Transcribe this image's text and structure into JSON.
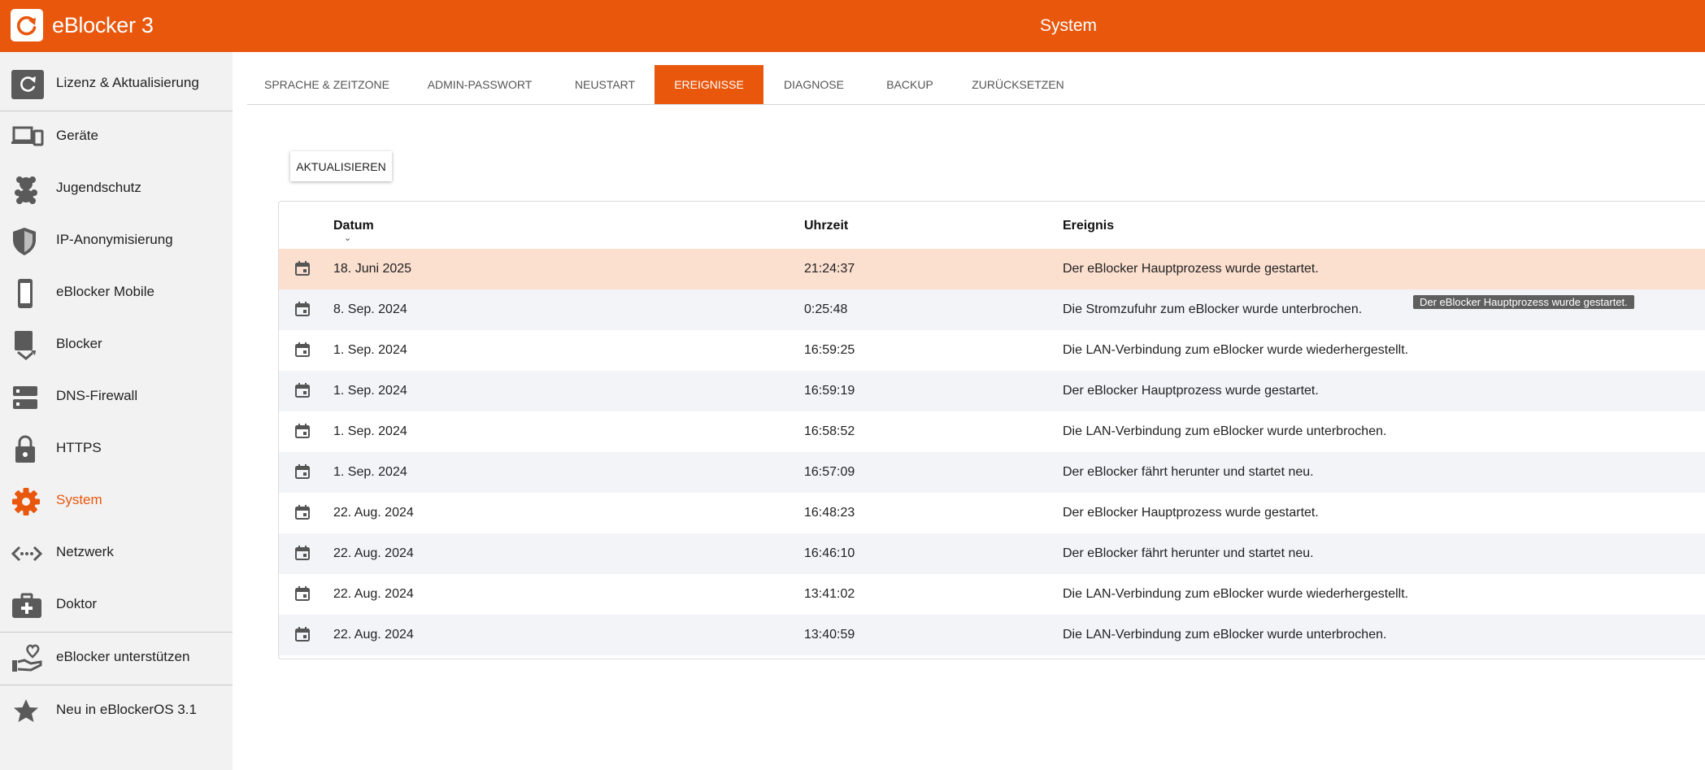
{
  "app": {
    "brand": "eBlocker 3",
    "page_title": "System"
  },
  "sidebar": {
    "items": [
      {
        "label": "Lizenz & Aktualisierung",
        "icon": "license-update-icon"
      },
      {
        "label": "Geräte",
        "icon": "devices-icon"
      },
      {
        "label": "Jugendschutz",
        "icon": "teddy-bear-icon"
      },
      {
        "label": "IP-Anonymisierung",
        "icon": "shield-icon"
      },
      {
        "label": "eBlocker Mobile",
        "icon": "smartphone-icon"
      },
      {
        "label": "Blocker",
        "icon": "blocker-icon"
      },
      {
        "label": "DNS-Firewall",
        "icon": "dns-server-icon"
      },
      {
        "label": "HTTPS",
        "icon": "lock-icon"
      },
      {
        "label": "System",
        "icon": "gear-icon",
        "active": true
      },
      {
        "label": "Netzwerk",
        "icon": "network-icon"
      },
      {
        "label": "Doktor",
        "icon": "doctor-bag-icon"
      },
      {
        "label": "eBlocker unterstützen",
        "icon": "heart-hand-icon"
      },
      {
        "label": "Neu in eBlockerOS 3.1",
        "icon": "star-icon"
      }
    ]
  },
  "tabs": [
    {
      "label": "Sprache & Zeitzone"
    },
    {
      "label": "Admin-Passwort"
    },
    {
      "label": "Neustart"
    },
    {
      "label": "Ereignisse",
      "active": true
    },
    {
      "label": "Diagnose"
    },
    {
      "label": "Backup"
    },
    {
      "label": "Zurücksetzen"
    }
  ],
  "events": {
    "refresh_label": "AKTUALISIEREN",
    "columns": {
      "date": "Datum",
      "time": "Uhrzeit",
      "event": "Ereignis"
    },
    "rows": [
      {
        "date": "18. Juni 2025",
        "time": "21:24:37",
        "event": "Der eBlocker Hauptprozess wurde gestartet."
      },
      {
        "date": "8. Sep. 2024",
        "time": "0:25:48",
        "event": "Die Stromzufuhr zum eBlocker wurde unterbrochen."
      },
      {
        "date": "1. Sep. 2024",
        "time": "16:59:25",
        "event": "Die LAN-Verbindung zum eBlocker wurde wiederhergestellt."
      },
      {
        "date": "1. Sep. 2024",
        "time": "16:59:19",
        "event": "Der eBlocker Hauptprozess wurde gestartet."
      },
      {
        "date": "1. Sep. 2024",
        "time": "16:58:52",
        "event": "Die LAN-Verbindung zum eBlocker wurde unterbrochen."
      },
      {
        "date": "1. Sep. 2024",
        "time": "16:57:09",
        "event": "Der eBlocker fährt herunter und startet neu."
      },
      {
        "date": "22. Aug. 2024",
        "time": "16:48:23",
        "event": "Der eBlocker Hauptprozess wurde gestartet."
      },
      {
        "date": "22. Aug. 2024",
        "time": "16:46:10",
        "event": "Der eBlocker fährt herunter und startet neu."
      },
      {
        "date": "22. Aug. 2024",
        "time": "13:41:02",
        "event": "Die LAN-Verbindung zum eBlocker wurde wiederhergestellt."
      },
      {
        "date": "22. Aug. 2024",
        "time": "13:40:59",
        "event": "Die LAN-Verbindung zum eBlocker wurde unterbrochen."
      }
    ],
    "tooltip": "Der eBlocker Hauptprozess wurde gestartet."
  },
  "colors": {
    "accent": "#e9570d",
    "highlight_row": "#fbdfcf",
    "alt_row": "#f3f4f8",
    "sidebar_bg": "#f2f2f2",
    "icon_gray": "#5a5a5a"
  }
}
